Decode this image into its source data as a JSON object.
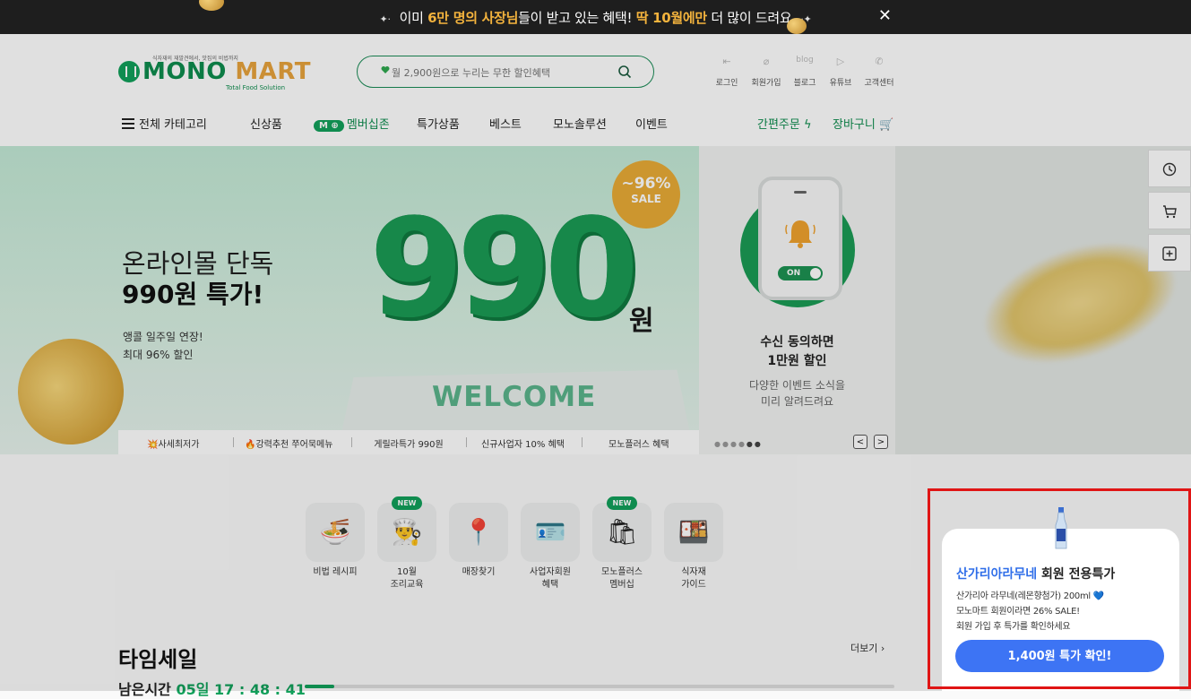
{
  "topbar": {
    "pre": "이미 ",
    "hl1": "6만 명의 사장님",
    "mid": "들이 받고 있는 혜택! ",
    "hl2": "딱 10월에만",
    "post": " 더 많이 드려요",
    "close": "✕"
  },
  "logo": {
    "slogan": "식자재의 재발견에서, 맛집의 비법까지",
    "mono": "MONO",
    "mart": "MART",
    "sub": "Total Food Solution"
  },
  "search": {
    "placeholder": "월 2,900원으로 누리는 무한 할인혜택"
  },
  "util": [
    "로그인",
    "회원가입",
    "블로그",
    "유튜브",
    "고객센터"
  ],
  "util_blog_mark": "blog",
  "nav": {
    "all": "전체 카테고리",
    "new": "신상품",
    "member_badge": "M",
    "member": "멤버십존",
    "special": "특가상품",
    "best": "베스트",
    "solution": "모노솔루션",
    "event": "이벤트",
    "quick_order": "간편주문",
    "cart": "장바구니"
  },
  "hero": {
    "title1": "온라인몰 단독",
    "title2": "990원 특가!",
    "desc1": "앵콜 일주일 연장!",
    "desc2": "최대 96% 할인",
    "big": "990",
    "won": "원",
    "welcome": "WELCOME",
    "sale_pct": "~96%",
    "sale_word": "SALE",
    "tabs": [
      "💥사세최저가",
      "🔥강력추천 쭈어묵메뉴",
      "게릴라특가 990원",
      "신규사업자 10% 혜택",
      "모노플러스 혜택"
    ],
    "active_tab": 2,
    "side_title1": "수신 동의하면",
    "side_title2": "1만원 할인",
    "side_sub1": "다양한 이벤트 소식을",
    "side_sub2": "미리 알려드려요",
    "toggle": "ON",
    "prev": "<",
    "next": ">"
  },
  "quick": [
    {
      "line1": "비법 레시피",
      "line2": "",
      "icon": "🍜",
      "new": false
    },
    {
      "line1": "10월",
      "line2": "조리교육",
      "icon": "👨‍🍳",
      "new": true
    },
    {
      "line1": "매장찾기",
      "line2": "",
      "icon": "📍",
      "new": false
    },
    {
      "line1": "사업자회원",
      "line2": "혜택",
      "icon": "🪪",
      "new": false
    },
    {
      "line1": "모노플러스",
      "line2": "멤버십",
      "icon": "🛍",
      "new": true
    },
    {
      "line1": "식자재",
      "line2": "가이드",
      "icon": "🍱",
      "new": false
    }
  ],
  "new_badge": "NEW",
  "timesale": {
    "title": "타임세일",
    "more": "더보기",
    "remain_label": "남은시간",
    "time": "05일 17 : 48 : 41"
  },
  "popup": {
    "title_blue": "산가리아라무네",
    "title_rest": " 회원 전용특가",
    "line1": "산가리아 라무네(레몬향첨가) 200ml 💙",
    "line2": "모노마트 회원이라면 26% SALE!",
    "line3": "회원 가입 후 특가를 확인하세요",
    "cta": "1,400원 특가 확인!"
  },
  "colors": {
    "brand_green": "#12a05b",
    "accent_gold": "#e8a33d",
    "popup_blue": "#3d74f4",
    "highlight_red": "#e01515"
  }
}
